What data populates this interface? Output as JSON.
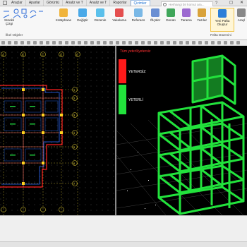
{
  "tabs": [
    "Araçlar",
    "Aparlar",
    "Görüntü",
    "Analiz ve T",
    "Analiz ve T",
    "Raporlar",
    "Çizimler"
  ],
  "active_tab_index": 6,
  "search": {
    "placeholder": "Herhangi bir komut ara..."
  },
  "help": "?",
  "window_buttons": [
    "▢",
    "✕"
  ],
  "ribbon": {
    "line_group_items": [
      "Sürekli Çizgi"
    ],
    "buttons": [
      "Kütüphane",
      "Değiştir",
      "Düzenle",
      "Yakalama",
      "Referans",
      "Ölçüler",
      "Donatı",
      "Tarama",
      "Yazılar",
      "Yeni Pafta Oluştur",
      "Araçl"
    ],
    "group_labels": [
      "İlkel Objeler",
      "Pafta Düzenini"
    ]
  },
  "left_axes": {
    "column_labels": [
      "A",
      "B",
      "C",
      "D",
      "E"
    ],
    "row_labels": [
      "1",
      "2",
      "3",
      "4",
      "5",
      "6",
      "7"
    ]
  },
  "right_view": {
    "title": "Tüm yeterli/yetersiz",
    "legend": [
      {
        "label": "YETERSİZ",
        "color": "#ff1a1a"
      },
      {
        "label": "YETERLİ",
        "color": "#22e23c"
      }
    ]
  },
  "colors": {
    "accent": "#1a6fd1",
    "plan_red": "#ff2020",
    "plan_blue": "#2c6bff",
    "model_green": "#22e23c"
  }
}
